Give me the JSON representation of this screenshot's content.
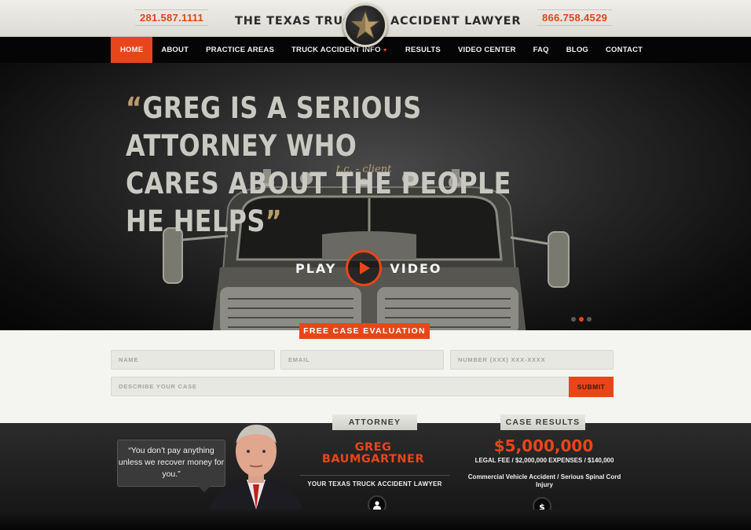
{
  "header": {
    "phone_left": "281.587.1111",
    "phone_right": "866.758.4529",
    "brand_left": "THE TEXAS TRUCK",
    "brand_right": "ACCIDENT LAWYER",
    "logo_icon": "star-icon"
  },
  "nav": {
    "items": [
      {
        "label": "HOME"
      },
      {
        "label": "ABOUT"
      },
      {
        "label": "PRACTICE AREAS"
      },
      {
        "label": "TRUCK ACCIDENT INFO"
      },
      {
        "label": "RESULTS"
      },
      {
        "label": "VIDEO CENTER"
      },
      {
        "label": "FAQ"
      },
      {
        "label": "BLOG"
      },
      {
        "label": "CONTACT"
      }
    ],
    "active": "HOME"
  },
  "hero": {
    "quote_open": "“",
    "quote_line1": "GREG IS A SERIOUS ATTORNEY WHO",
    "quote_line2": "CARES ABOUT THE PEOPLE HE HELPS",
    "quote_close": "”",
    "attribution": "t.c. - client",
    "play_label": "PLAY",
    "video_label": "VIDEO",
    "slides_total": 3,
    "slide_active": 2
  },
  "form": {
    "tab_label": "FREE CASE EVALUATION",
    "name_placeholder": "NAME",
    "email_placeholder": "EMAIL",
    "number_placeholder": "NUMBER (XXX) XXX-XXXX",
    "describe_placeholder": "DESCRIBE YOUR CASE",
    "submit_label": "SUBMIT"
  },
  "testimonial": {
    "text": "“You don’t pay anything unless we recover money for you.”"
  },
  "attorney": {
    "tab_label": "ATTORNEY",
    "name_line1": "GREG",
    "name_line2": "BAUMGARTNER",
    "role": "YOUR TEXAS TRUCK ACCIDENT LAWYER",
    "icon": "person-icon"
  },
  "case_results": {
    "tab_label": "CASE RESULTS",
    "amount": "$5,000,000",
    "fee_line": "LEGAL FEE / $2,000,000  EXPENSES / $140,000",
    "description": "Commercial Vehicle Accident / Serious Spinal Cord Injury",
    "icon": "dollar-icon"
  },
  "colors": {
    "accent": "#e8461a",
    "gold": "#b89d6b"
  }
}
